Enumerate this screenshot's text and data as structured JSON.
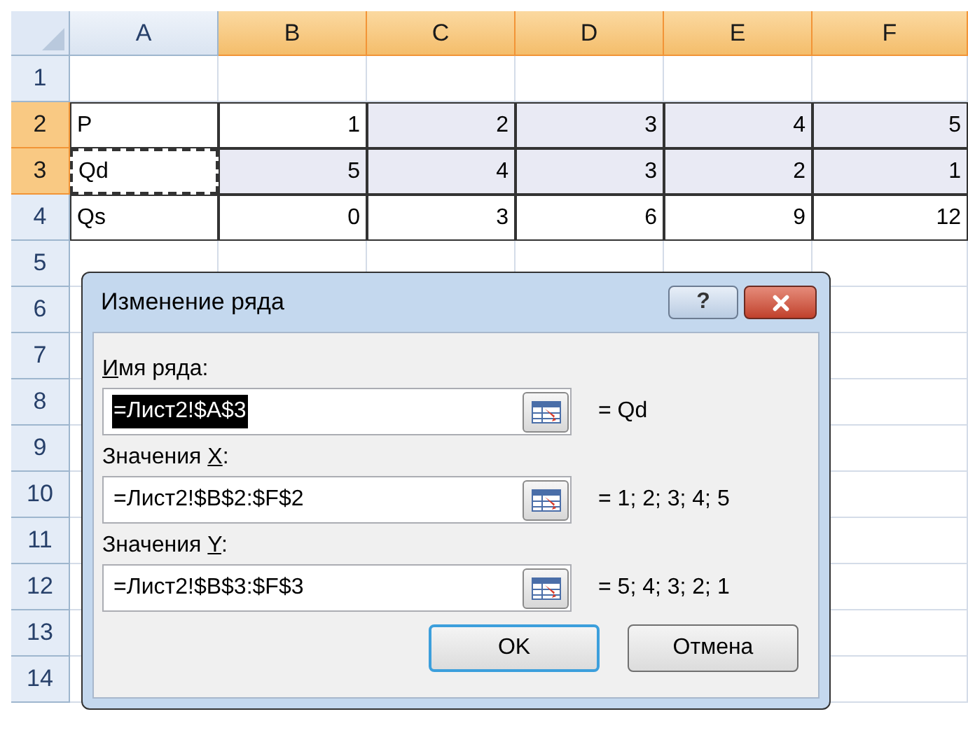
{
  "sheet": {
    "columns": [
      {
        "label": "A",
        "selected": false
      },
      {
        "label": "B",
        "selected": true
      },
      {
        "label": "C",
        "selected": true
      },
      {
        "label": "D",
        "selected": true
      },
      {
        "label": "E",
        "selected": true
      },
      {
        "label": "F",
        "selected": true
      }
    ],
    "rows": [
      {
        "label": "1",
        "selected": false,
        "cells": []
      },
      {
        "label": "2",
        "selected": true,
        "cells": [
          {
            "text": "P",
            "selected": false
          },
          {
            "text": "1",
            "selected": false
          },
          {
            "text": "2",
            "selected": true
          },
          {
            "text": "3",
            "selected": true
          },
          {
            "text": "4",
            "selected": true
          },
          {
            "text": "5",
            "selected": true
          }
        ]
      },
      {
        "label": "3",
        "selected": true,
        "cells": [
          {
            "text": "Qd",
            "selected": false,
            "marquee": true
          },
          {
            "text": "5",
            "selected": true
          },
          {
            "text": "4",
            "selected": true
          },
          {
            "text": "3",
            "selected": true
          },
          {
            "text": "2",
            "selected": true
          },
          {
            "text": "1",
            "selected": true
          }
        ]
      },
      {
        "label": "4",
        "selected": false,
        "cells": [
          {
            "text": "Qs",
            "selected": false
          },
          {
            "text": "0",
            "selected": false
          },
          {
            "text": "3",
            "selected": false
          },
          {
            "text": "6",
            "selected": false
          },
          {
            "text": "9",
            "selected": false
          },
          {
            "text": "12",
            "selected": false
          }
        ]
      },
      {
        "label": "5",
        "selected": false,
        "cells": []
      },
      {
        "label": "6",
        "selected": false,
        "cells": []
      },
      {
        "label": "7",
        "selected": false,
        "cells": []
      },
      {
        "label": "8",
        "selected": false,
        "cells": []
      },
      {
        "label": "9",
        "selected": false,
        "cells": []
      },
      {
        "label": "10",
        "selected": false,
        "cells": []
      },
      {
        "label": "11",
        "selected": false,
        "cells": []
      },
      {
        "label": "12",
        "selected": false,
        "cells": []
      },
      {
        "label": "13",
        "selected": false,
        "cells": []
      },
      {
        "label": "14",
        "selected": false,
        "cells": []
      }
    ]
  },
  "dialog": {
    "title": "Изменение ряда",
    "help": "?",
    "fields": [
      {
        "access_key": "И",
        "label_post": "мя ряда:",
        "value": "=Лист2!$A$3",
        "value_selected": true,
        "result": "= Qd"
      },
      {
        "label_pre": "Значения ",
        "access_key": "X",
        "label_post": ":",
        "value": "=Лист2!$B$2:$F$2",
        "value_selected": false,
        "result": "= 1; 2; 3; 4; 5"
      },
      {
        "label_pre": "Значения ",
        "access_key": "Y",
        "label_post": ":",
        "value": "=Лист2!$B$3:$F$3",
        "value_selected": false,
        "result": "= 5; 4; 3; 2; 1"
      }
    ],
    "buttons": [
      {
        "label": "OK",
        "default": true
      },
      {
        "label": "Отмена",
        "default": false
      }
    ]
  }
}
